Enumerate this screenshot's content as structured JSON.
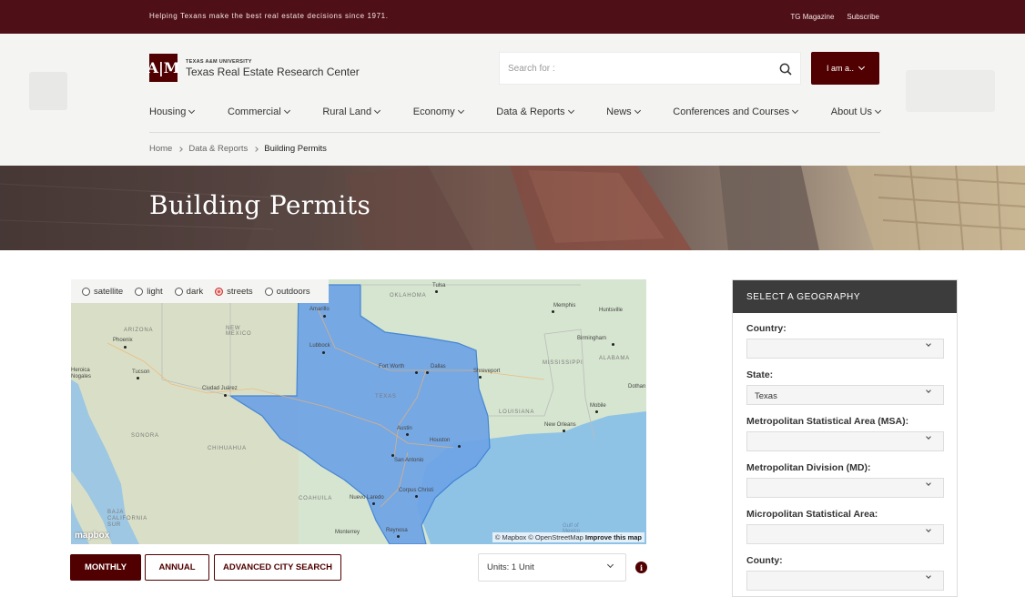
{
  "topbar": {
    "tagline": "Helping Texans make the best real estate decisions since 1971.",
    "links": [
      "TG Magazine",
      "Subscribe"
    ]
  },
  "header": {
    "logo_mark": "A|M",
    "logo_small": "TEXAS A&M UNIVERSITY",
    "logo_name": "Texas Real Estate Research Center",
    "search_placeholder": "Search for :",
    "iam_label": "I am a.."
  },
  "nav": [
    "Housing",
    "Commercial",
    "Rural Land",
    "Economy",
    "Data & Reports",
    "News",
    "Conferences and Courses",
    "About Us"
  ],
  "breadcrumb": [
    "Home",
    "Data & Reports",
    "Building Permits"
  ],
  "hero": {
    "title": "Building Permits"
  },
  "map": {
    "styles": [
      {
        "label": "satellite",
        "selected": false
      },
      {
        "label": "light",
        "selected": false
      },
      {
        "label": "dark",
        "selected": false
      },
      {
        "label": "streets",
        "selected": true
      },
      {
        "label": "outdoors",
        "selected": false
      }
    ],
    "labels": {
      "oklahoma": "OKLAHOMA",
      "tulsa": "Tulsa",
      "memphis": "Memphis",
      "huntsville": "Huntsville",
      "amarillo": "Amarillo",
      "arizona": "ARIZONA",
      "new_mexico": "NEW\nMEXICO",
      "lubbock": "Lubbock",
      "phoenix": "Phoenix",
      "birmingham": "Birmingham",
      "mississippi": "MISSISSIPPI",
      "alabama": "ALABAMA",
      "fort_worth": "Fort Worth",
      "dallas": "Dallas",
      "shreveport": "Shreveport",
      "tucson": "Tucson",
      "heroica": "Heroica\nNogales",
      "ciudad_juarez": "Ciudad Juárez",
      "texas": "TEXAS",
      "louisiana": "LOUISIANA",
      "mobile": "Mobile",
      "new_orleans": "New Orleans",
      "sonora": "SONORA",
      "austin": "Austin",
      "houston": "Houston",
      "chihuahua": "CHIHUAHUA",
      "san_antonio": "San Antonio",
      "coahuila": "COAHUILA",
      "nuevo_laredo": "Nuevo Laredo",
      "corpus_christi": "Corpus Christi",
      "baja": "BAJA\nCALIFORNIA\nSUR",
      "reynosa": "Reynosa",
      "gulf": "Gulf of\nMexico",
      "dothan": "Dothan",
      "monterrey": "Monterrey"
    },
    "mapbox_logo": "mapbox",
    "attribution_a": "© Mapbox © OpenStreetMap",
    "attribution_b": "Improve this map"
  },
  "buttons": {
    "monthly": "MONTHLY",
    "annual": "ANNUAL",
    "advanced": "ADVANCED CITY SEARCH",
    "units": "Units: 1 Unit",
    "info": "i"
  },
  "geography": {
    "title": "SELECT A GEOGRAPHY",
    "fields": [
      {
        "label": "Country:",
        "value": ""
      },
      {
        "label": "State:",
        "value": "Texas"
      },
      {
        "label": "Metropolitan Statistical Area (MSA):",
        "value": ""
      },
      {
        "label": "Metropolitan Division (MD):",
        "value": ""
      },
      {
        "label": "Micropolitan Statistical Area:",
        "value": ""
      },
      {
        "label": "County:",
        "value": ""
      }
    ]
  }
}
